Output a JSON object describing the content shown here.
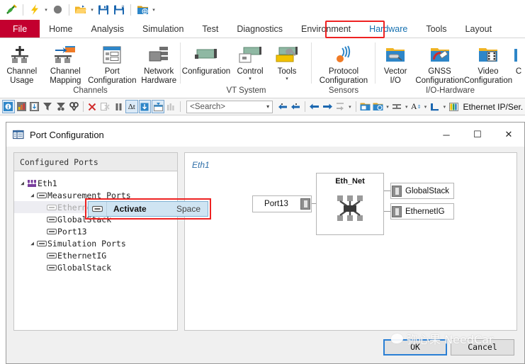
{
  "quick_access": {
    "items": [
      {
        "name": "canoe-logo-icon",
        "label": "CANoe"
      },
      {
        "name": "lightning-icon",
        "label": "Start"
      },
      {
        "name": "stop-record-icon",
        "label": "Stop"
      },
      {
        "name": "open-folder-icon",
        "label": "Open"
      },
      {
        "name": "save-icon",
        "label": "Save"
      },
      {
        "name": "save-as-icon",
        "label": "Save As"
      },
      {
        "name": "configuration-icon",
        "label": "Configuration"
      },
      {
        "name": "customize-caret-icon",
        "label": "Customize Quick Access Toolbar"
      }
    ]
  },
  "ribbon": {
    "tabs": [
      {
        "label": "File",
        "active": false,
        "kind": "file"
      },
      {
        "label": "Home",
        "active": false,
        "kind": "normal"
      },
      {
        "label": "Analysis",
        "active": false,
        "kind": "normal"
      },
      {
        "label": "Simulation",
        "active": false,
        "kind": "normal"
      },
      {
        "label": "Test",
        "active": false,
        "kind": "normal"
      },
      {
        "label": "Diagnostics",
        "active": false,
        "kind": "normal"
      },
      {
        "label": "Environment",
        "active": false,
        "kind": "normal"
      },
      {
        "label": "Hardware",
        "active": true,
        "kind": "normal"
      },
      {
        "label": "Tools",
        "active": false,
        "kind": "normal"
      },
      {
        "label": "Layout",
        "active": false,
        "kind": "normal"
      }
    ],
    "highlight_tab": "Hardware",
    "groups": [
      {
        "name": "Channels",
        "buttons": [
          {
            "label_line1": "Channel",
            "label_line2": "Usage",
            "icon": "channel-usage-icon",
            "dropdown": false,
            "highlighted": false
          },
          {
            "label_line1": "Channel",
            "label_line2": "Mapping",
            "icon": "channel-mapping-icon",
            "dropdown": false,
            "highlighted": false
          },
          {
            "label_line1": "Port",
            "label_line2": "Configuration",
            "icon": "port-configuration-icon",
            "dropdown": false,
            "highlighted": true
          },
          {
            "label_line1": "Network",
            "label_line2": "Hardware",
            "icon": "network-hardware-icon",
            "dropdown": false,
            "highlighted": false
          }
        ]
      },
      {
        "name": "VT System",
        "buttons": [
          {
            "label_line1": "Configuration",
            "label_line2": "",
            "icon": "vt-configuration-icon",
            "dropdown": false,
            "highlighted": false
          },
          {
            "label_line1": "Control",
            "label_line2": "",
            "icon": "vt-control-icon",
            "dropdown": true,
            "highlighted": false
          },
          {
            "label_line1": "Tools",
            "label_line2": "",
            "icon": "vt-tools-icon",
            "dropdown": true,
            "highlighted": false
          }
        ]
      },
      {
        "name": "Sensors",
        "buttons": [
          {
            "label_line1": "Protocol",
            "label_line2": "Configuration",
            "icon": "protocol-configuration-icon",
            "dropdown": false,
            "highlighted": false
          }
        ]
      },
      {
        "name": "I/O-Hardware",
        "buttons": [
          {
            "label_line1": "Vector",
            "label_line2": "I/O",
            "icon": "vector-io-icon",
            "dropdown": false,
            "highlighted": false
          },
          {
            "label_line1": "GNSS",
            "label_line2": "Configuration",
            "icon": "gnss-configuration-icon",
            "dropdown": false,
            "highlighted": false
          },
          {
            "label_line1": "Video",
            "label_line2": "Configuration",
            "icon": "video-configuration-icon",
            "dropdown": false,
            "highlighted": false
          },
          {
            "label_line1": "C",
            "label_line2": "",
            "icon": "clipped-configuration-icon",
            "dropdown": false,
            "highlighted": false
          }
        ]
      }
    ]
  },
  "toolbar": {
    "left_icons": [
      {
        "name": "measurement-info-icon",
        "boxed": true
      },
      {
        "name": "statistics-icon",
        "boxed": false
      },
      {
        "name": "trace-window-icon",
        "boxed": false
      },
      {
        "name": "filter-icon",
        "boxed": false
      },
      {
        "name": "filter-remove-icon",
        "boxed": false
      },
      {
        "name": "find-icon",
        "boxed": false
      }
    ],
    "mid_icons": [
      {
        "name": "clear-icon",
        "boxed": false
      },
      {
        "name": "clear-all-icon",
        "boxed": false
      },
      {
        "name": "pause-icon",
        "boxed": false
      },
      {
        "name": "time-delta-icon",
        "boxed": true
      },
      {
        "name": "scroll-down-icon",
        "boxed": true
      },
      {
        "name": "auto-scroll-icon",
        "boxed": true
      },
      {
        "name": "columns-icon",
        "boxed": false
      }
    ],
    "search": {
      "value": "<Search>",
      "placeholder": "<Search>",
      "dropdown": true
    },
    "right_icons": [
      {
        "name": "prev-match-icon"
      },
      {
        "name": "next-match-icon"
      },
      {
        "name": "back-icon"
      },
      {
        "name": "forward-icon"
      },
      {
        "name": "goto-icon"
      },
      {
        "name": "config-folder-icon"
      },
      {
        "name": "config-options-icon"
      },
      {
        "name": "row-height-icon"
      },
      {
        "name": "font-size-icon"
      },
      {
        "name": "layout-icon"
      },
      {
        "name": "color-legend-icon"
      }
    ],
    "status_label": "Ethernet IP/Ser."
  },
  "dialog": {
    "title": "Port Configuration",
    "title_icon": "port-configuration-window-icon",
    "window_controls": [
      {
        "name": "minimize-button",
        "glyph": "─"
      },
      {
        "name": "maximize-button",
        "glyph": "☐"
      },
      {
        "name": "close-button",
        "glyph": "✕"
      }
    ],
    "tree": {
      "header": "Configured Ports",
      "nodes": [
        {
          "label": "Eth1",
          "level": 0,
          "expander": "◢",
          "icon": "network-cluster-icon",
          "selected": false,
          "disabled": false
        },
        {
          "label": "Measurement Ports",
          "level": 1,
          "expander": "◢",
          "icon": "port-icon",
          "selected": false,
          "disabled": false
        },
        {
          "label": "EthernetIG",
          "level": 2,
          "expander": "",
          "icon": "port-icon",
          "selected": true,
          "disabled": true
        },
        {
          "label": "GlobalStack",
          "level": 2,
          "expander": "",
          "icon": "port-icon",
          "selected": false,
          "disabled": false
        },
        {
          "label": "Port13",
          "level": 2,
          "expander": "",
          "icon": "port-icon",
          "selected": false,
          "disabled": false
        },
        {
          "label": "Simulation Ports",
          "level": 1,
          "expander": "◢",
          "icon": "port-icon",
          "selected": false,
          "disabled": false
        },
        {
          "label": "EthernetIG",
          "level": 2,
          "expander": "",
          "icon": "port-icon",
          "selected": false,
          "disabled": false
        },
        {
          "label": "GlobalStack",
          "level": 2,
          "expander": "",
          "icon": "port-icon",
          "selected": false,
          "disabled": false
        }
      ]
    },
    "canvas": {
      "network_label": "Eth1",
      "port_node": "Port13",
      "hub_node": "Eth_Net",
      "stack_nodes": [
        "GlobalStack",
        "EthernetIG"
      ]
    },
    "context_menu": {
      "item_label": "Activate",
      "shortcut": "Space",
      "icon": "port-icon",
      "highlighted": true
    },
    "buttons": {
      "ok": "OK",
      "cancel": "Cancel"
    }
  },
  "watermark": {
    "text": "弥心果 NeedCar",
    "icon": "wechat-bubble-icon"
  },
  "colors": {
    "file_tab": "#c3002f",
    "active_tab_text": "#1570b0",
    "highlight_red": "#ee2222",
    "accent_blue": "#2a7fd4",
    "context_menu_bg": "#cfe4f2",
    "device_green": "#86b09a"
  }
}
